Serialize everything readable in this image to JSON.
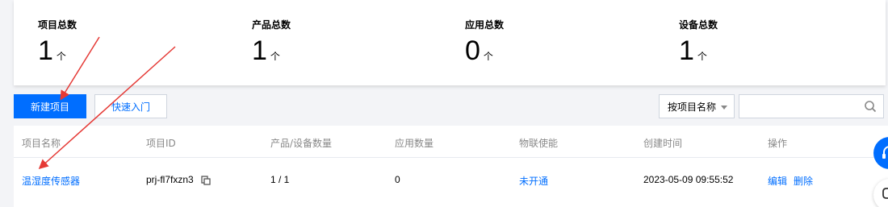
{
  "stats": [
    {
      "label": "项目总数",
      "value": "1",
      "unit": "个"
    },
    {
      "label": "产品总数",
      "value": "1",
      "unit": "个"
    },
    {
      "label": "应用总数",
      "value": "0",
      "unit": "个"
    },
    {
      "label": "设备总数",
      "value": "1",
      "unit": "个"
    }
  ],
  "toolbar": {
    "create_label": "新建项目",
    "quickstart_label": "快速入门",
    "filter_selected": "按项目名称",
    "search_placeholder": ""
  },
  "table": {
    "headers": [
      "项目名称",
      "项目ID",
      "产品/设备数量",
      "应用数量",
      "物联使能",
      "创建时间",
      "操作"
    ],
    "rows": [
      {
        "name": "温湿度传感器",
        "id": "prj-fl7fxzn3",
        "product_device": "1 / 1",
        "app_count": "0",
        "iot_enable": "未开通",
        "created": "2023-05-09 09:55:52",
        "edit": "编辑",
        "delete": "删除"
      }
    ]
  },
  "colors": {
    "primary": "#006eff",
    "annotation_arrow": "#e53935"
  },
  "icons": [
    "search-icon",
    "copy-icon",
    "headset-icon",
    "chat-icon",
    "caret-down-icon"
  ]
}
